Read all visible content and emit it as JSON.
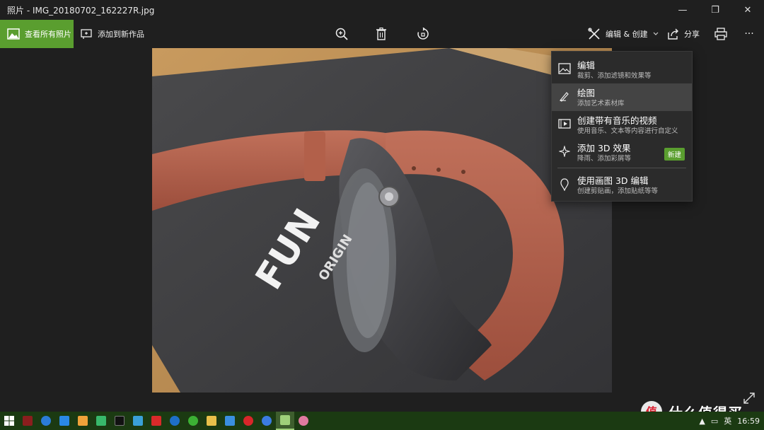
{
  "window": {
    "title": "照片 - IMG_20180702_162227R.jpg",
    "minimize_glyph": "—",
    "restore_glyph": "❐",
    "close_glyph": "✕"
  },
  "toolbar": {
    "view_all_label": "查看所有照片",
    "add_to_new_label": "添加到新作品",
    "zoom_icon": "zoom-in-icon",
    "delete_icon": "trash-icon",
    "rotate_icon": "rotate-icon",
    "edit_create_label": "编辑 & 创建",
    "share_label": "分享",
    "print_icon": "printer-icon",
    "more_label": "···"
  },
  "menu": {
    "items": [
      {
        "title": "编辑",
        "subtitle": "裁剪、添加滤镜和效果等",
        "icon": "edit-image-icon"
      },
      {
        "title": "绘图",
        "subtitle": "添加艺术素材库",
        "icon": "pen-icon"
      },
      {
        "title": "创建带有音乐的视频",
        "subtitle": "使用音乐、文本等内容进行自定义",
        "icon": "video-icon"
      },
      {
        "title": "添加 3D 效果",
        "subtitle": "降雨、添加彩屑等",
        "icon": "sparkle-icon",
        "badge": "新建"
      },
      {
        "title": "使用画图 3D 编辑",
        "subtitle": "创建剪贴画，添加贴纸等等",
        "icon": "paint3d-icon"
      }
    ]
  },
  "photo": {
    "brand_text": "FUN",
    "sub_text": "ORIGIN"
  },
  "taskbar": {
    "apps": [
      "windows",
      "app-red",
      "browser-blue",
      "wps",
      "app-orange",
      "app-green",
      "terminal",
      "app-colorful",
      "app-red2",
      "app-blue",
      "wechat",
      "explorer",
      "app-bird",
      "opera",
      "chrome",
      "photos",
      "paint"
    ],
    "lang": "英",
    "time": "16:59"
  },
  "watermark": {
    "text": "什么值得买"
  },
  "colors": {
    "accent": "#5a9e2f",
    "background": "#1f1f1f",
    "menu_bg": "#2b2b2b",
    "taskbar": "#1b3a12"
  }
}
